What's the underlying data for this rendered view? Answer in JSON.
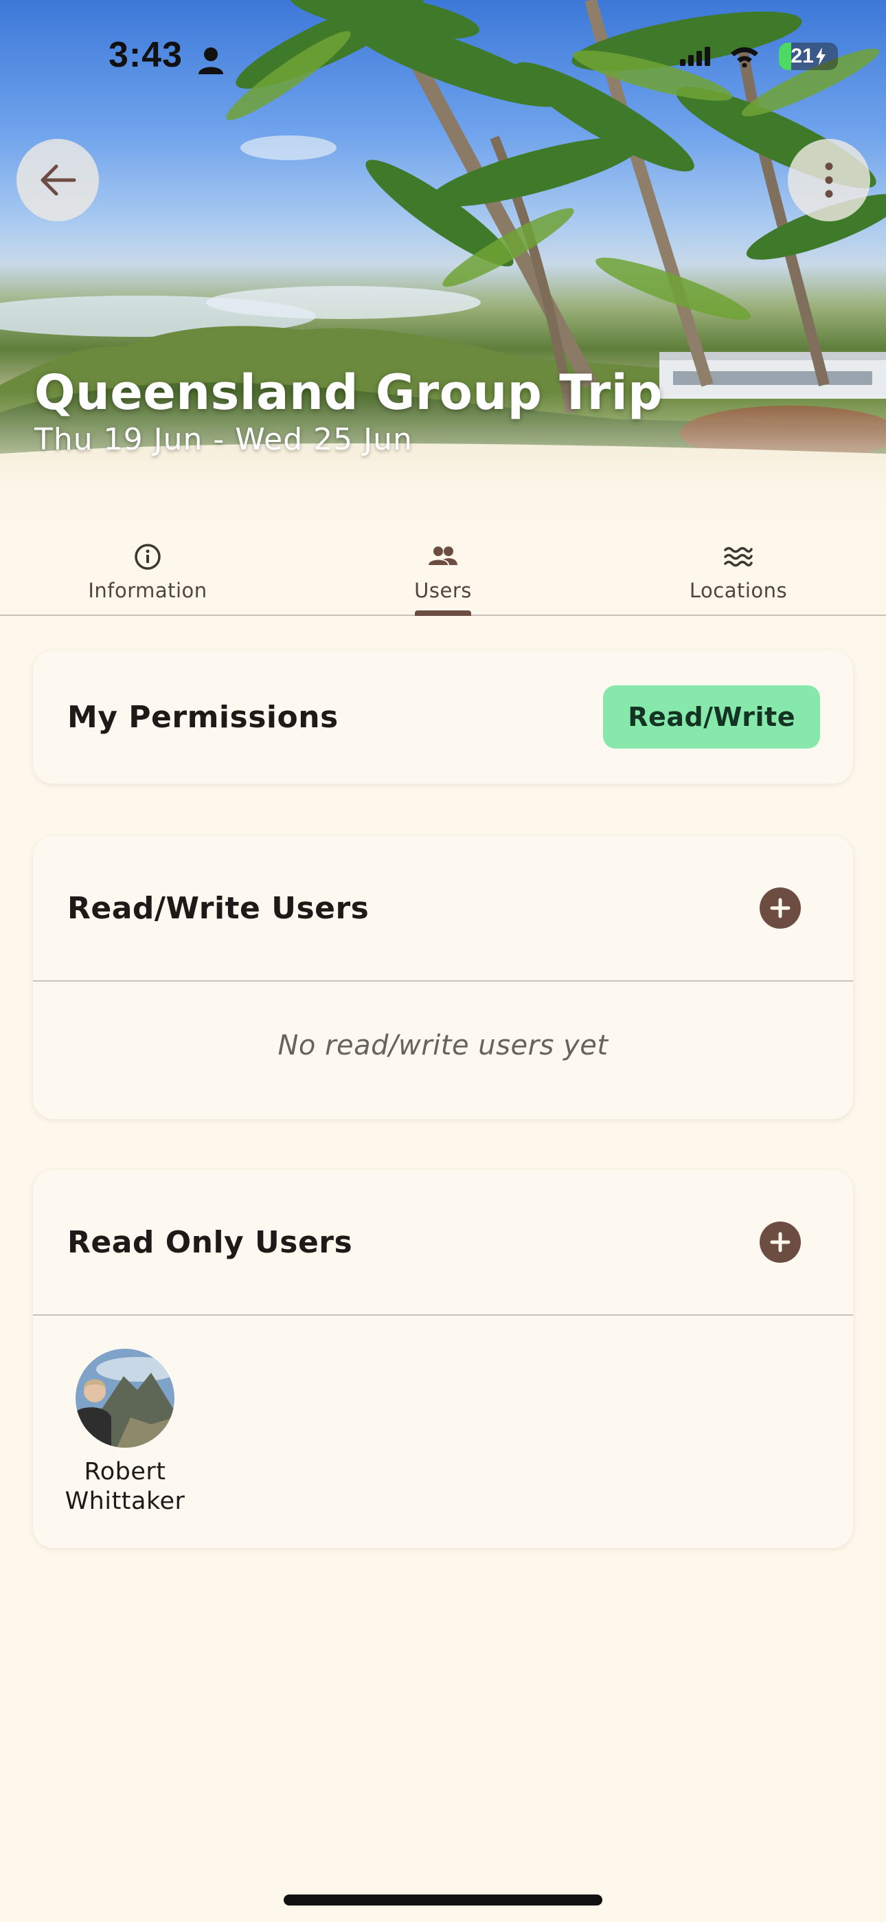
{
  "status_bar": {
    "time": "3:43",
    "battery": "21"
  },
  "trip": {
    "title": "Queensland Group Trip",
    "dates": "Thu 19 Jun - Wed 25 Jun"
  },
  "tabs": [
    {
      "label": "Information",
      "icon": "info-icon",
      "active": false
    },
    {
      "label": "Users",
      "icon": "people-icon",
      "active": true
    },
    {
      "label": "Locations",
      "icon": "waves-icon",
      "active": false
    }
  ],
  "permissions": {
    "title": "My Permissions",
    "value": "Read/Write",
    "badge_color": "#86E8AB"
  },
  "read_write_users": {
    "title": "Read/Write Users",
    "empty_text": "No read/write users yet",
    "users": []
  },
  "read_only_users": {
    "title": "Read Only Users",
    "users": [
      {
        "name": "Robert Whittaker"
      }
    ]
  },
  "colors": {
    "background": "#FDF8EB",
    "accent": "#6D4C41"
  }
}
